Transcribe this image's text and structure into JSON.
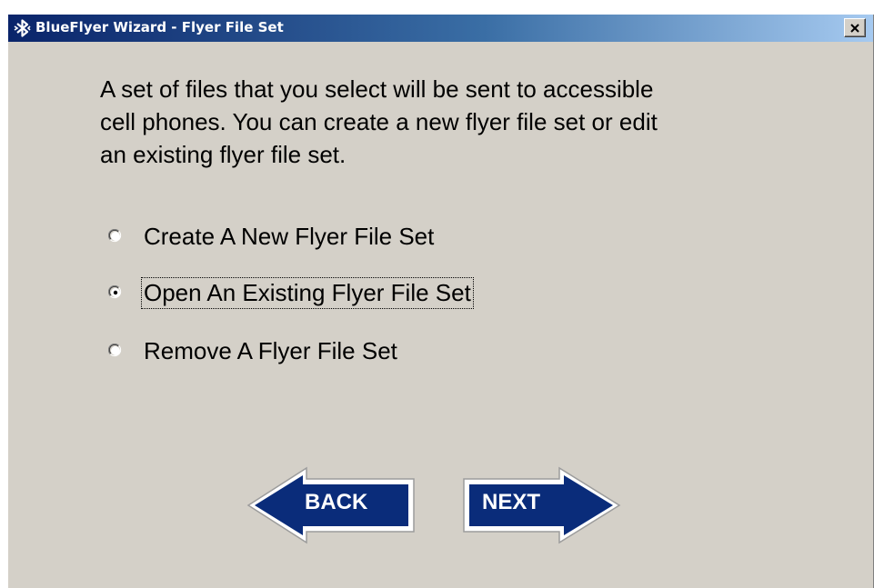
{
  "window": {
    "title": "BlueFlyer Wizard - Flyer File Set",
    "icon": "bluetooth-icon",
    "close_icon": "close-icon"
  },
  "intro": {
    "lines": [
      "A set of files that you select will be sent to accessible",
      "cell phones.  You can create a new flyer file set or edit",
      "an existing flyer file set."
    ]
  },
  "options": [
    {
      "label": "Create A New Flyer File Set",
      "selected": false
    },
    {
      "label": "Open An Existing Flyer File Set",
      "selected": true
    },
    {
      "label": "Remove A Flyer File Set",
      "selected": false
    }
  ],
  "buttons": {
    "back_label": "BACK",
    "next_label": "NEXT"
  },
  "colors": {
    "face": "#d4d0c8",
    "title_start": "#0a246a",
    "title_end": "#a6caf0",
    "arrow_fill": "#0a2c7a"
  }
}
